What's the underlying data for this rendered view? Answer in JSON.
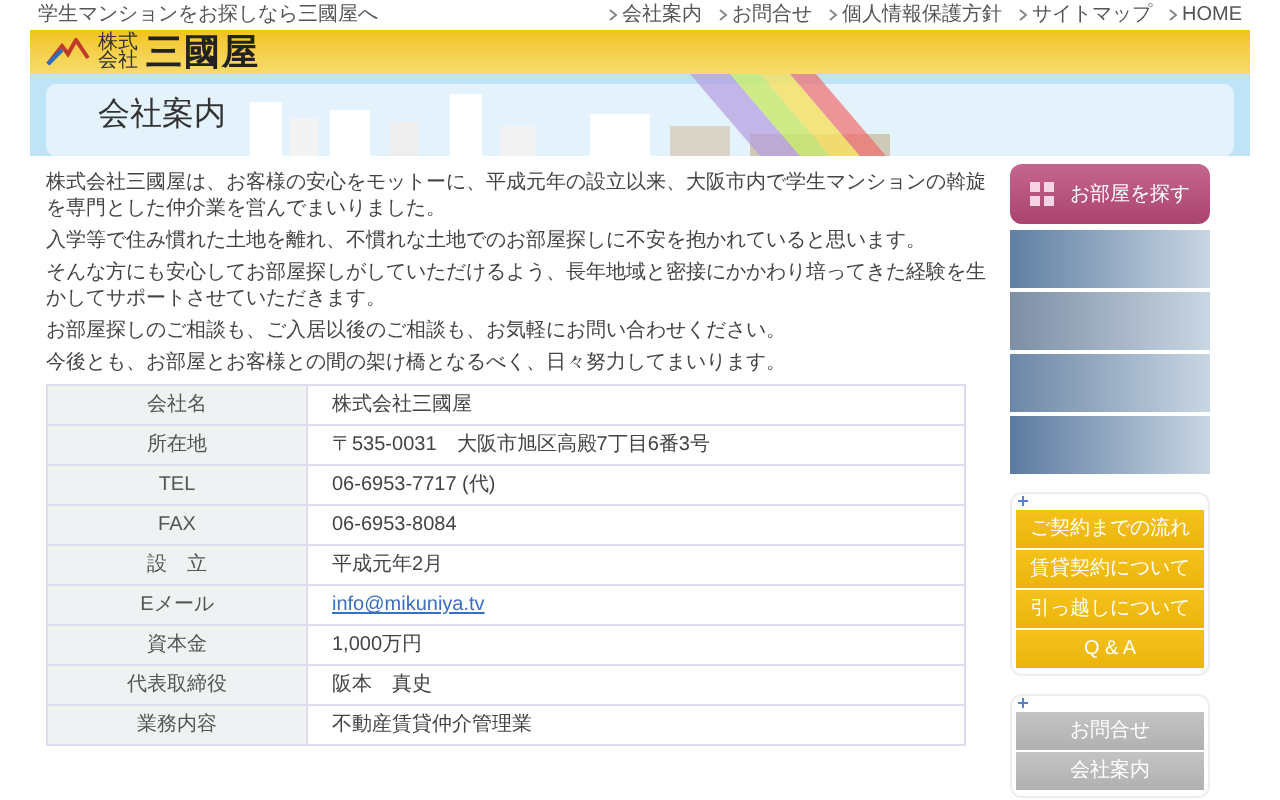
{
  "top_bar": {
    "tagline": "学生マンションをお探しなら三國屋へ",
    "links": [
      "会社案内",
      "お問合せ",
      "個人情報保護方針",
      "サイトマップ",
      "HOME"
    ]
  },
  "logo": {
    "prefix": [
      "株式",
      "会社"
    ],
    "name": "三國屋"
  },
  "page_title": "会社案内",
  "intro": [
    "株式会社三國屋は、お客様の安心をモットーに、平成元年の設立以来、大阪市内で学生マンションの斡旋を専門とした仲介業を営んでまいりました。",
    "入学等で住み慣れた土地を離れ、不慣れな土地でのお部屋探しに不安を抱かれていると思います。",
    "そんな方にも安心してお部屋探しがしていただけるよう、長年地域と密接にかかわり培ってきた経験を生かしてサポートさせていただきます。",
    "お部屋探しのご相談も、ご入居以後のご相談も、お気軽にお問い合わせください。",
    "今後とも、お部屋とお客様との間の架け橋となるべく、日々努力してまいります。"
  ],
  "company_table": [
    {
      "label": "会社名",
      "value": "株式会社三國屋",
      "kind": "text"
    },
    {
      "label": "所在地",
      "value": "〒535-0031　大阪市旭区高殿7丁目6番3号",
      "kind": "text"
    },
    {
      "label": "TEL",
      "value": "06-6953-7717 (代)",
      "kind": "text"
    },
    {
      "label": "FAX",
      "value": "06-6953-8084",
      "kind": "text"
    },
    {
      "label": "設　立",
      "value": "平成元年2月",
      "kind": "text"
    },
    {
      "label": "Eメール",
      "value": "info@mikuniya.tv",
      "kind": "link"
    },
    {
      "label": "資本金",
      "value": "1,000万円",
      "kind": "text"
    },
    {
      "label": "代表取締役",
      "value": "阪本　真史",
      "kind": "text"
    },
    {
      "label": "業務内容",
      "value": "不動産賃貸仲介管理業",
      "kind": "text"
    }
  ],
  "sidebar": {
    "search_button": "お部屋を探す",
    "guide_menu": [
      "ご契約までの流れ",
      "賃貸契約について",
      "引っ越しについて",
      "Q & A"
    ],
    "info_menu": [
      "お問合せ",
      "会社案内"
    ]
  }
}
